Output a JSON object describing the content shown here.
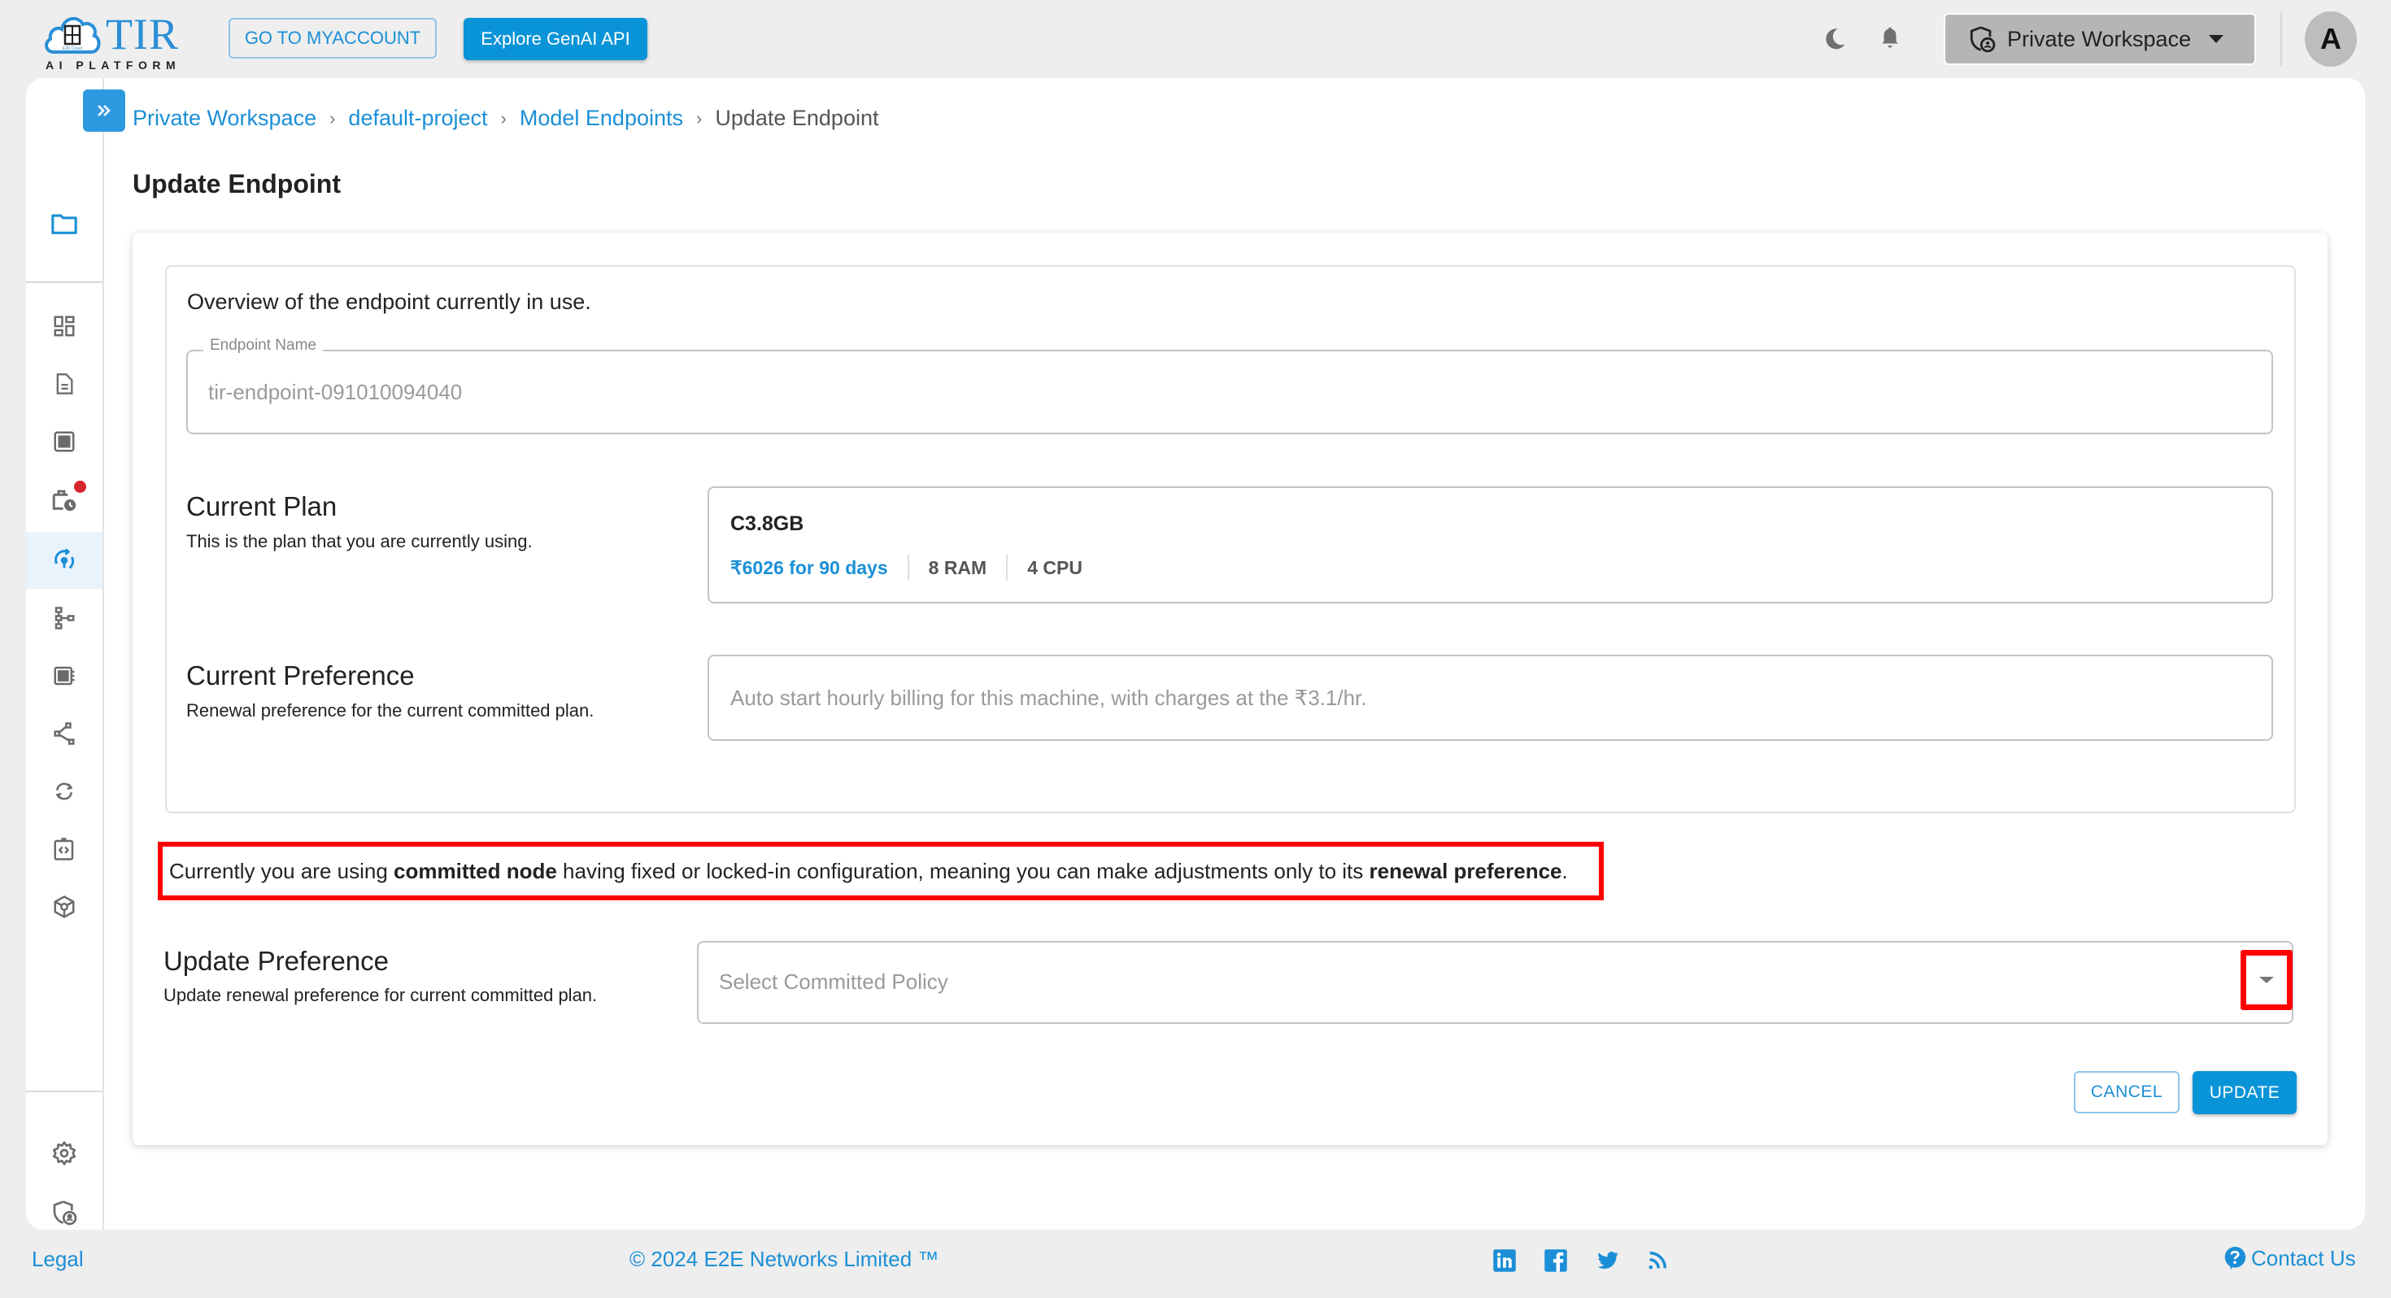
{
  "header": {
    "logo_title": "TIR",
    "logo_subtitle": "AI PLATFORM",
    "logo_cloud_text": "E2E Cloud",
    "go_to_myaccount_label": "GO TO MYACCOUNT",
    "explore_genai_label": "Explore GenAI API",
    "workspace_selector": "Private Workspace",
    "avatar_initial": "A",
    "icons": [
      "moon-icon",
      "bell-icon",
      "shield-user-icon",
      "caret-down-icon"
    ]
  },
  "sidebar": {
    "items": [
      {
        "icon": "folder-icon",
        "active": false,
        "selected_color": true
      },
      {
        "icon": "dashboard-icon",
        "active": false
      },
      {
        "icon": "document-icon",
        "active": false
      },
      {
        "icon": "grid-icon",
        "active": false
      },
      {
        "icon": "briefcase-clock-icon",
        "active": false,
        "badge": true
      },
      {
        "icon": "model-endpoint-icon",
        "active": true
      },
      {
        "icon": "pipeline-icon",
        "active": false
      },
      {
        "icon": "dataset-icon",
        "active": false
      },
      {
        "icon": "share-nodes-icon",
        "active": false
      },
      {
        "icon": "sync-icon",
        "active": false
      },
      {
        "icon": "code-clipboard-icon",
        "active": false
      },
      {
        "icon": "cube-icon",
        "active": false
      }
    ],
    "bottom_items": [
      {
        "icon": "settings-icon"
      },
      {
        "icon": "shield-user-icon"
      }
    ]
  },
  "breadcrumb": [
    {
      "label": "Private Workspace",
      "link": true
    },
    {
      "label": "default-project",
      "link": true
    },
    {
      "label": "Model Endpoints",
      "link": true
    },
    {
      "label": "Update Endpoint",
      "link": false
    }
  ],
  "breadcrumb_separator": "›",
  "page_title": "Update Endpoint",
  "form": {
    "overview_text": "Overview of the endpoint currently in use.",
    "endpoint_name_label": "Endpoint Name",
    "endpoint_name_value": "tir-endpoint-091010094040",
    "current_plan": {
      "title": "Current Plan",
      "description": "This is the plan that you are currently using.",
      "plan_name": "C3.8GB",
      "price": "₹6026 for 90 days",
      "ram": "8 RAM",
      "cpu": "4 CPU"
    },
    "current_preference": {
      "title": "Current Preference",
      "description": "Renewal preference for the current committed plan.",
      "value": "Auto start hourly billing for this machine, with charges at the ₹3.1/hr."
    },
    "notice": {
      "part1": "Currently you are using ",
      "bold1": "committed node",
      "part2": " having fixed or locked-in configuration, meaning you can make adjustments only to its ",
      "bold2": "renewal preference",
      "part3": "."
    },
    "update_preference": {
      "title": "Update Preference",
      "description": "Update renewal preference for current committed plan.",
      "select_placeholder": "Select Committed Policy"
    },
    "cancel_label": "CANCEL",
    "update_label": "UPDATE"
  },
  "footer": {
    "legal": "Legal",
    "copyright": "© 2024 E2E Networks Limited ™",
    "social": [
      "linkedin-icon",
      "facebook-icon",
      "twitter-icon",
      "rss-icon"
    ],
    "contact": "Contact Us"
  },
  "colors": {
    "brand": "#0a94d8",
    "link": "#1b8fd6",
    "highlight": "#ff0000",
    "badge": "#d6262d"
  }
}
